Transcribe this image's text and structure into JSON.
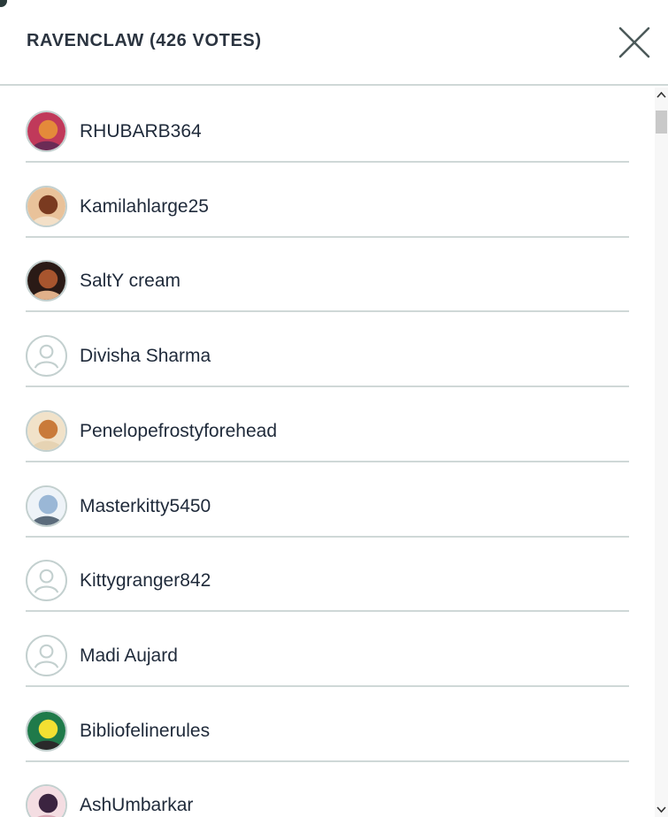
{
  "dialog": {
    "title": "RAVENCLAW (426 VOTES)",
    "close_icon": "close-icon"
  },
  "voters": [
    {
      "name": "RHUBARB364",
      "avatar": "photo",
      "colors": [
        "#c0395a",
        "#e48a3a",
        "#6b2b55"
      ]
    },
    {
      "name": "Kamilahlarge25",
      "avatar": "photo",
      "colors": [
        "#e9c29a",
        "#7a3a20",
        "#f3e0c8"
      ]
    },
    {
      "name": "SaltY cream",
      "avatar": "photo",
      "colors": [
        "#2a1a16",
        "#a8552e",
        "#e0b08a"
      ]
    },
    {
      "name": "Divisha Sharma",
      "avatar": "placeholder",
      "colors": [
        "#c3d0cf"
      ]
    },
    {
      "name": "Penelopefrostyforehead",
      "avatar": "photo",
      "colors": [
        "#f1e2c9",
        "#c97a3a",
        "#e6d3b3"
      ]
    },
    {
      "name": "Masterkitty5450",
      "avatar": "photo",
      "colors": [
        "#eef3f8",
        "#9ab7d6",
        "#5b6b7b"
      ]
    },
    {
      "name": "Kittygranger842",
      "avatar": "placeholder",
      "colors": [
        "#c3d0cf"
      ]
    },
    {
      "name": "Madi Aujard",
      "avatar": "placeholder",
      "colors": [
        "#c3d0cf"
      ]
    },
    {
      "name": "Bibliofelinerules",
      "avatar": "photo",
      "colors": [
        "#1f7a4a",
        "#f3e032",
        "#2a2a2a"
      ]
    },
    {
      "name": "AshUmbarkar",
      "avatar": "photo",
      "colors": [
        "#f4dde2",
        "#3b2440",
        "#d9a7b4"
      ]
    }
  ],
  "scrollbar": {
    "up_icon": "scroll-up-arrow-icon",
    "down_icon": "scroll-down-arrow-icon"
  }
}
